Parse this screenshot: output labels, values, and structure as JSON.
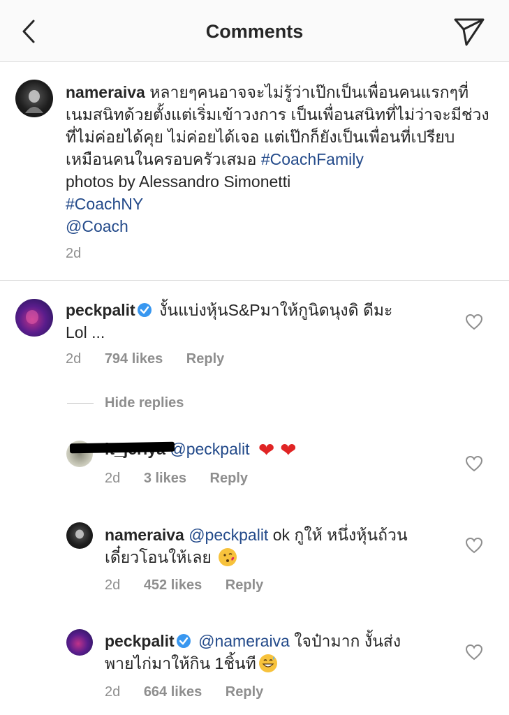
{
  "header": {
    "title": "Comments"
  },
  "caption": {
    "username": "nameraiva",
    "text_line1": "หลายๆคนอาจจะไม่รู้ว่าเป๊กเป็นเพื่อนคนแรกๆที่",
    "text_line2": "เนมสนิทด้วยตั้งแต่เริ่มเข้าวงการ เป็นเพื่อนสนิทที่ไม่ว่าจะมีช่วง",
    "text_line3": "ที่ไม่ค่อยได้คุย ไม่ค่อยได้เจอ แต่เป๊กก็ยังเป็นเพื่อนที่เปรียบ",
    "text_line4": "เหมือนคนในครอบครัวเสมอ",
    "hashtag1": "#CoachFamily",
    "credit": "photos by Alessandro Simonetti",
    "hashtag2": "#CoachNY",
    "mention": "@Coach",
    "time": "2d"
  },
  "comments": [
    {
      "username": "peckpalit",
      "verified": true,
      "line1": "งั้นแบ่งหุ้นS&Pมาให้กูนิดนุงดิ ดีมะ",
      "line2": "Lol ...",
      "time": "2d",
      "likes": "794 likes",
      "reply": "Reply"
    }
  ],
  "hide_replies": "Hide replies",
  "replies": [
    {
      "username": "it_jeriya",
      "mention": "@peckpalit",
      "emoji": "❤️ ❤️",
      "time": "2d",
      "likes": "3 likes",
      "reply": "Reply"
    },
    {
      "username": "nameraiva",
      "mention": "@peckpalit",
      "line1": "ok กูให้ หนึ่งหุ้นถ้วน",
      "line2": "เดี๋ยวโอนให้เลย",
      "emoji": "😘",
      "time": "2d",
      "likes": "452 likes",
      "reply": "Reply"
    },
    {
      "username": "peckpalit",
      "verified": true,
      "mention": "@nameraiva",
      "line1": "ใจป๋ามาก งั้นส่ง",
      "line2": "พายไก่มาให้กิน 1ชิ้นที",
      "emoji": "😅",
      "time": "2d",
      "likes": "664 likes",
      "reply": "Reply"
    }
  ],
  "icons": {
    "back": "chevron-left-icon",
    "send": "paper-plane-icon",
    "like": "heart-outline-icon",
    "verified": "verified-badge-icon"
  },
  "colors": {
    "link": "#234a8a",
    "verified": "#3897f0",
    "meta": "#8e8e8e",
    "heart": "#e02424"
  }
}
